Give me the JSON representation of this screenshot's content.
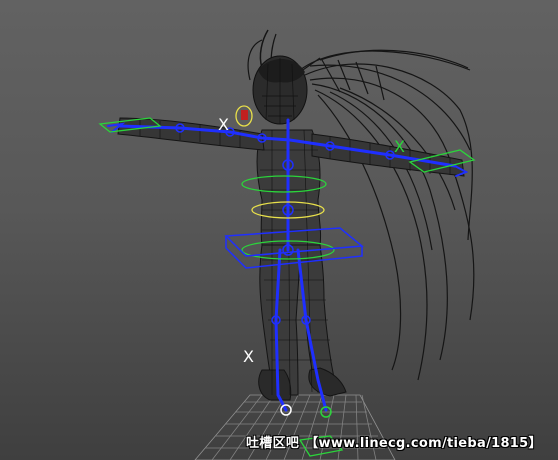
{
  "viewport": {
    "background_top": "#626262",
    "background_bottom": "#3f3f3f",
    "mesh_color": "#1a1a1a",
    "skeleton_color": "#1f2fff",
    "handle_color_green": "#2bd43b",
    "handle_color_yellow": "#e8e04a",
    "grid_color": "#8a8a8a"
  },
  "locators": {
    "left_marker": "X",
    "right_marker": "X",
    "lower_marker": "X"
  },
  "watermark": {
    "site_name": "吐槽区吧",
    "url": "【www.linecg.com/tieba/1815】"
  }
}
